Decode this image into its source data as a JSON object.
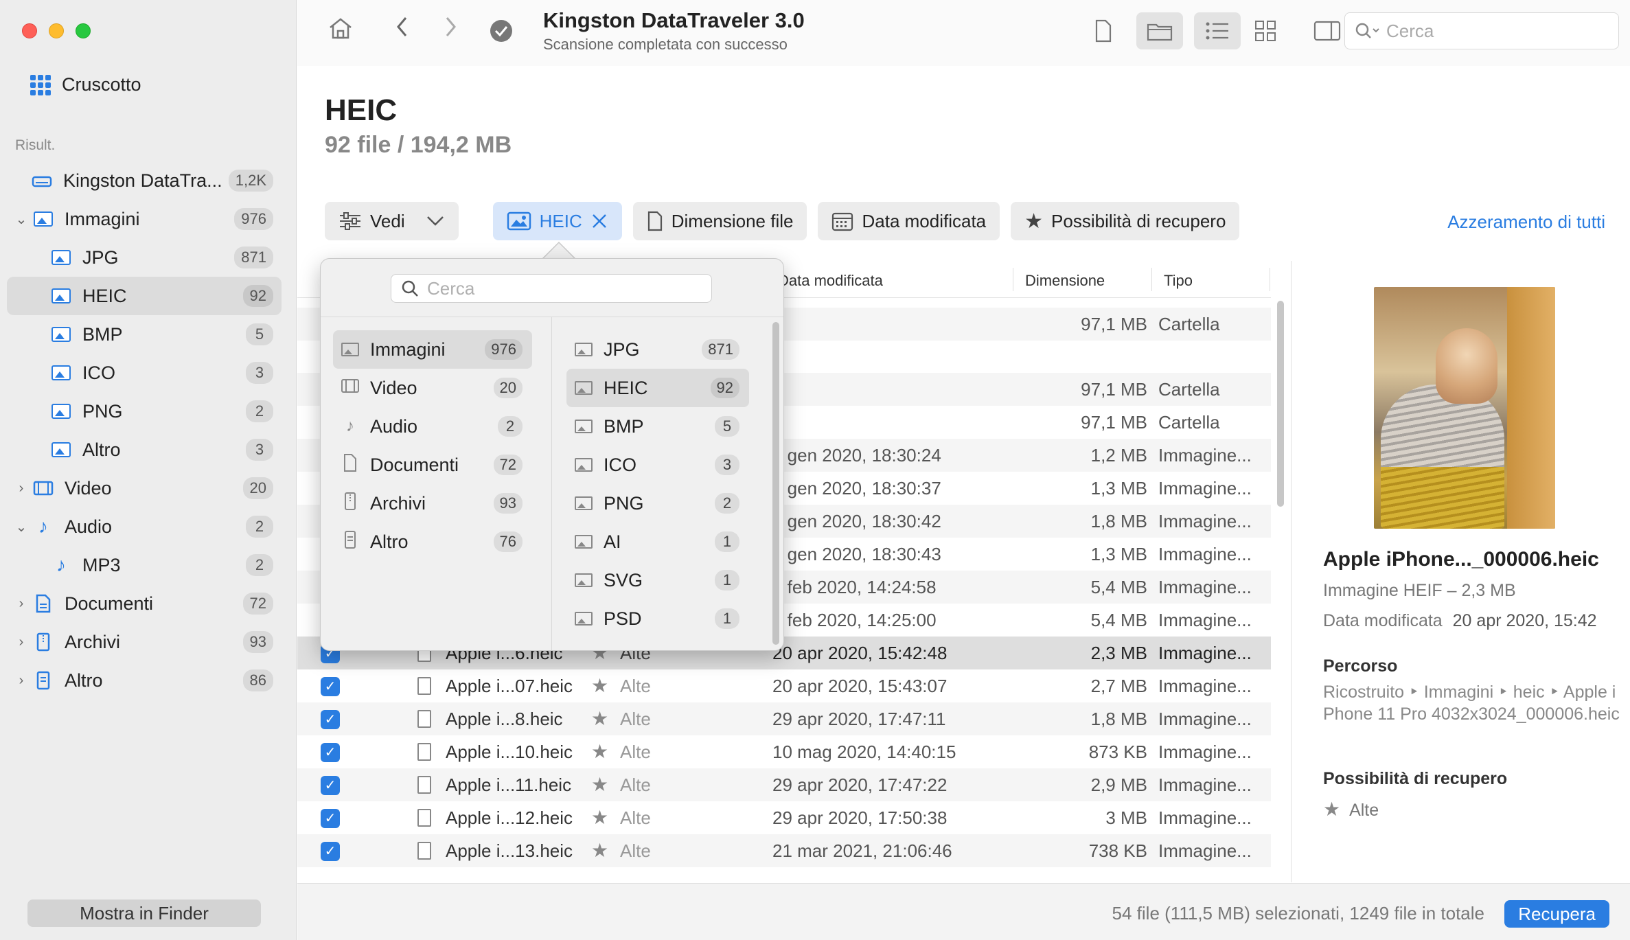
{
  "window": {
    "title": "Kingston DataTraveler 3.0",
    "subtitle": "Scansione completata con successo",
    "search_placeholder": "Cerca"
  },
  "sidebar": {
    "dashboard": "Cruscotto",
    "results_label": "Risult.",
    "items": [
      {
        "label": "Kingston DataTra...",
        "count": "1,2K"
      },
      {
        "label": "Immagini",
        "count": "976"
      },
      {
        "label": "JPG",
        "count": "871"
      },
      {
        "label": "HEIC",
        "count": "92"
      },
      {
        "label": "BMP",
        "count": "5"
      },
      {
        "label": "ICO",
        "count": "3"
      },
      {
        "label": "PNG",
        "count": "2"
      },
      {
        "label": "Altro",
        "count": "3"
      },
      {
        "label": "Video",
        "count": "20"
      },
      {
        "label": "Audio",
        "count": "2"
      },
      {
        "label": "MP3",
        "count": "2"
      },
      {
        "label": "Documenti",
        "count": "72"
      },
      {
        "label": "Archivi",
        "count": "93"
      },
      {
        "label": "Altro",
        "count": "86"
      }
    ],
    "finder_button": "Mostra in Finder"
  },
  "header": {
    "title": "HEIC",
    "summary": "92 file / 194,2 MB"
  },
  "filters": {
    "view": "Vedi",
    "heic": "HEIC",
    "size": "Dimensione file",
    "date": "Data modificata",
    "recovery": "Possibilità di recupero",
    "reset": "Azzeramento di tutti"
  },
  "table": {
    "columns": {
      "date": "Data modificata",
      "size": "Dimensione",
      "type": "Tipo"
    },
    "rows": [
      {
        "name": "",
        "rec": "",
        "date": "-",
        "size": "97,1 MB",
        "type": "Cartella"
      },
      {
        "name": "",
        "rec": "",
        "date": "-",
        "size": "97,1 MB",
        "type": "Cartella"
      },
      {
        "name": "",
        "rec": "",
        "date": "-",
        "size": "97,1 MB",
        "type": "Cartella"
      },
      {
        "name": "",
        "rec": "",
        "date": "5 gen 2020, 18:30:24",
        "size": "1,2 MB",
        "type": "Immagine..."
      },
      {
        "name": "",
        "rec": "",
        "date": "5 gen 2020, 18:30:37",
        "size": "1,3 MB",
        "type": "Immagine..."
      },
      {
        "name": "",
        "rec": "",
        "date": "5 gen 2020, 18:30:42",
        "size": "1,8 MB",
        "type": "Immagine..."
      },
      {
        "name": "",
        "rec": "",
        "date": "5 gen 2020, 18:30:43",
        "size": "1,3 MB",
        "type": "Immagine..."
      },
      {
        "name": "",
        "rec": "",
        "date": "6 feb 2020, 14:24:58",
        "size": "5,4 MB",
        "type": "Immagine..."
      },
      {
        "name": "",
        "rec": "",
        "date": "6 feb 2020, 14:25:00",
        "size": "5,4 MB",
        "type": "Immagine..."
      },
      {
        "name": "Apple i...6.heic",
        "rec": "Alte",
        "date": "20 apr 2020, 15:42:48",
        "size": "2,3 MB",
        "type": "Immagine..."
      },
      {
        "name": "Apple i...07.heic",
        "rec": "Alte",
        "date": "20 apr 2020, 15:43:07",
        "size": "2,7 MB",
        "type": "Immagine..."
      },
      {
        "name": "Apple i...8.heic",
        "rec": "Alte",
        "date": "29 apr 2020, 17:47:11",
        "size": "1,8 MB",
        "type": "Immagine..."
      },
      {
        "name": "Apple i...10.heic",
        "rec": "Alte",
        "date": "10 mag 2020, 14:40:15",
        "size": "873 KB",
        "type": "Immagine..."
      },
      {
        "name": "Apple i...11.heic",
        "rec": "Alte",
        "date": "29 apr 2020, 17:47:22",
        "size": "2,9 MB",
        "type": "Immagine..."
      },
      {
        "name": "Apple i...12.heic",
        "rec": "Alte",
        "date": "29 apr 2020, 17:50:38",
        "size": "3 MB",
        "type": "Immagine..."
      },
      {
        "name": "Apple i...13.heic",
        "rec": "Alte",
        "date": "21 mar 2021, 21:06:46",
        "size": "738 KB",
        "type": "Immagine..."
      }
    ]
  },
  "preview": {
    "name": "Apple iPhone..._000006.heic",
    "kind": "Immagine HEIF – 2,3 MB",
    "modified_label": "Data modificata",
    "modified_value": "20 apr 2020, 15:42",
    "path_title": "Percorso",
    "path": "Ricostruito ‣ Immagini ‣ heic ‣ Apple iPhone 11 Pro 4032x3024_000006.heic",
    "recovery_title": "Possibilità di recupero",
    "recovery_value": "Alte"
  },
  "popover": {
    "search_placeholder": "Cerca",
    "categories": [
      {
        "label": "Immagini",
        "count": "976",
        "icon": "image-icon"
      },
      {
        "label": "Video",
        "count": "20",
        "icon": "film-icon"
      },
      {
        "label": "Audio",
        "count": "2",
        "icon": "music-note-icon"
      },
      {
        "label": "Documenti",
        "count": "72",
        "icon": "document-icon"
      },
      {
        "label": "Archivi",
        "count": "93",
        "icon": "archive-icon"
      },
      {
        "label": "Altro",
        "count": "76",
        "icon": "other-file-icon"
      }
    ],
    "formats": [
      {
        "label": "JPG",
        "count": "871"
      },
      {
        "label": "HEIC",
        "count": "92"
      },
      {
        "label": "BMP",
        "count": "5"
      },
      {
        "label": "ICO",
        "count": "3"
      },
      {
        "label": "PNG",
        "count": "2"
      },
      {
        "label": "AI",
        "count": "1"
      },
      {
        "label": "SVG",
        "count": "1"
      },
      {
        "label": "PSD",
        "count": "1"
      }
    ]
  },
  "footer": {
    "status": "54 file (111,5 MB) selezionati, 1249 file in totale",
    "recover": "Recupera"
  },
  "colors": {
    "accent": "#2a7de1"
  }
}
